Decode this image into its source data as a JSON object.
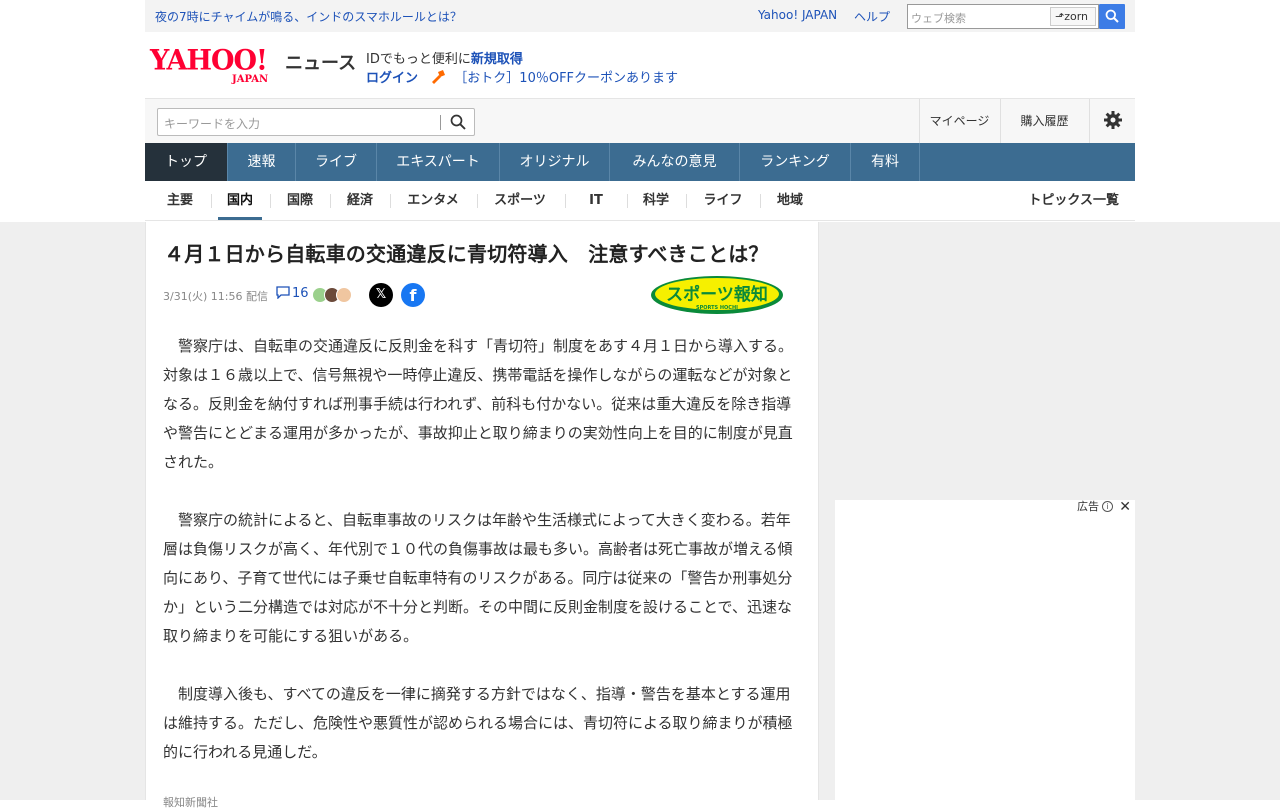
{
  "top_bar": {
    "promo_link": "夜の7時にチャイムが鳴る、インドのスマホルールとは？",
    "yahoo_japan_link": "Yahoo! JAPAN",
    "help_link": "ヘルプ",
    "web_search_placeholder": "ウェブ検索",
    "zorn_label": "zorn"
  },
  "header": {
    "logo_main": "YAHOO!",
    "logo_sub": "JAPAN",
    "service_name": "ニュース",
    "id_prefix": "IDでもっと便利に",
    "id_signup": "新規取得",
    "login": "ログイン",
    "coupon": "［おトク］10％OFFクーポンあります"
  },
  "search_row": {
    "keyword_placeholder": "キーワードを入力",
    "mypage": "マイページ",
    "purchase_history": "購入履歴"
  },
  "main_nav": [
    {
      "label": "トップ",
      "active": true
    },
    {
      "label": "速報"
    },
    {
      "label": "ライブ"
    },
    {
      "label": "エキスパート"
    },
    {
      "label": "オリジナル"
    },
    {
      "label": "みんなの意見"
    },
    {
      "label": "ランキング"
    },
    {
      "label": "有料"
    }
  ],
  "sub_nav": {
    "items": [
      "主要",
      "国内",
      "国際",
      "経済",
      "エンタメ",
      "スポーツ",
      "IT",
      "科学",
      "ライフ",
      "地域"
    ],
    "active_index": 1,
    "topics_list": "トピックス一覧"
  },
  "article": {
    "headline": "４月１日から自転車の交通違反に青切符導入　注意すべきことは？",
    "date": "3/31(火) 11:56",
    "delivered": "配信",
    "comment_count": "16",
    "share_x": "𝕏",
    "share_facebook": "f",
    "source_logo_text": "スポーツ報知",
    "source_logo_sub": "SPORTS HOCHI",
    "paragraphs": [
      "警察庁は、自転車の交通違反に反則金を科す「青切符」制度をあす４月１日から導入する。対象は１６歳以上で、信号無視や一時停止違反、携帯電話を操作しながらの運転などが対象となる。反則金を納付すれば刑事手続は行われず、前科も付かない。従来は重大違反を除き指導や警告にとどまる運用が多かったが、事故抑止と取り締まりの実効性向上を目的に制度が見直された。",
      "警察庁の統計によると、自転車事故のリスクは年齢や生活様式によって大きく変わる。若年層は負傷リスクが高く、年代別で１０代の負傷事故は最も多い。高齢者は死亡事故が増える傾向にあり、子育て世代には子乗せ自転車特有のリスクがある。同庁は従来の「警告か刑事処分か」という二分構造では対応が不十分と判断。その中間に反則金制度を設けることで、迅速な取り締まりを可能にする狙いがある。",
      "制度導入後も、すべての違反を一律に摘発する方針ではなく、指導・警告を基本とする運用は維持する。ただし、危険性や悪質性が認められる場合には、青切符による取り締まりが積極的に行われる見通しだ。"
    ],
    "footer_note": "報知新聞社"
  },
  "ad": {
    "label": "広告",
    "info": "i",
    "close": "✕"
  },
  "colors": {
    "nav_bg": "#3c6c91",
    "nav_active": "#25313b",
    "link_blue": "#1d52b8",
    "yahoo_red": "#ff0033",
    "search_btn": "#3c7ce6"
  }
}
